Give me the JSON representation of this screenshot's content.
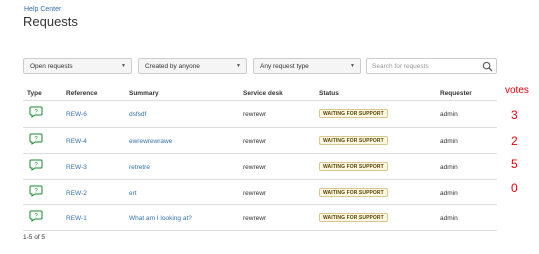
{
  "breadcrumb": "Help Center",
  "page_title": "Requests",
  "filters": {
    "requests": "Open requests",
    "created_by": "Created by anyone",
    "request_type": "Any request type",
    "search_placeholder": "Search for requests"
  },
  "table": {
    "columns": [
      "Type",
      "Reference",
      "Summary",
      "Service desk",
      "Status",
      "Requester"
    ],
    "rows": [
      {
        "reference": "REW-6",
        "summary": "dsfsdf",
        "service_desk": "rewrewr",
        "status": "WAITING FOR SUPPORT",
        "requester": "admin"
      },
      {
        "reference": "REW-4",
        "summary": "ewrewrewrawe",
        "service_desk": "rewrewr",
        "status": "WAITING FOR SUPPORT",
        "requester": "admin"
      },
      {
        "reference": "REW-3",
        "summary": "retretre",
        "service_desk": "rewrewr",
        "status": "WAITING FOR SUPPORT",
        "requester": "admin"
      },
      {
        "reference": "REW-2",
        "summary": "ert",
        "service_desk": "rewrewr",
        "status": "WAITING FOR SUPPORT",
        "requester": "admin"
      },
      {
        "reference": "REW-1",
        "summary": "What am I looking at?",
        "service_desk": "rewrewr",
        "status": "WAITING FOR SUPPORT",
        "requester": "admin"
      }
    ]
  },
  "votes": {
    "title": "votes",
    "values": [
      "3",
      "2",
      "5",
      "0"
    ]
  },
  "pagination": "1-5 of 5",
  "colors": {
    "link": "#3572b0",
    "status_bg": "#fcf8e3",
    "status_text": "#594300",
    "annotation": "#e8000b",
    "type_icon": "#14892c"
  },
  "icons": {
    "type": "chat-question-icon",
    "search": "search-icon",
    "dropdown": "chevron-down-icon"
  }
}
